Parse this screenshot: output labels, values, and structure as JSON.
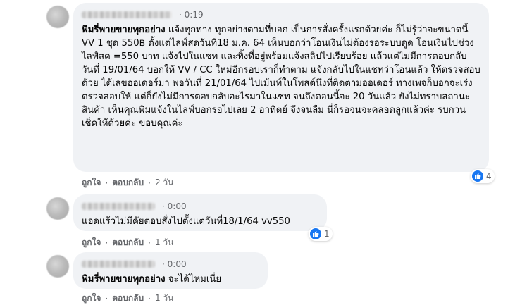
{
  "comments": [
    {
      "time": "0:19",
      "tagged_name": "พิมรี่พายขายทุกอย่าง",
      "text_after_tag": " แจ้งทุกทาง ทุกอย่างตามที่บอก เป็นการสั่งครั้งแรกด้วยค่ะ ก็ไม่รู้ว่าจะขนาดนี้",
      "body": "VV 1 ชุด 550฿ ตั้งแต่ไลฟ์สดวันที่18 ม.ค. 64 เห็นบอกว่าโอนเงินไม่ต้องรอระบบดูด โอนเงินไปช่วงไลฟ์สด =550 บาท แจ้งไปในแชท และทิ้งที่อยู่พร้อมแจ้งสลิปไปเรียบร้อย แล้วแต่ไม่มีการตอบกลับ วันที่ 19/01/64 บอกให้ VV / CC ใหม่อีกรอบเราก็ทำตาม แจ้งกลับไปในแชทว่าโอนแล้ว ให้ตรวจสอบด้วย ได้เลขออเดอร์มา พอวันที่ 21/01/64 ไปเม้นท์ในโพสต์นึงที่ติดตามออเดอร์ ทางเพจก็บอกจะเร่งตรวจสอบให้ แต่ก็ยังไม่มีการตอบกลับอะไรมาในแชท จนถึงตอนนี้จะ 20 วันแล้ว ยังไม่ทราบสถานะสินค้า เห็นคุณพิมแจ้งในไลฟ์บอกรอไปเลย 2 อาทิตย์ จึงจนลืม นี่ก็รอจนจะคลอดลูกแล้วค่ะ รบกวนเช็คให้ด้วยค่ะ ขอบคุณค่ะ",
      "like_label": "ถูกใจ",
      "reply_label": "ตอบกลับ",
      "age": "2 วัน",
      "reaction_count": "4"
    },
    {
      "time": "0:00",
      "text": "แอดแร้วไม่มีคัยตอบสั่งไปตั้งแต่วันที่18/1/64 vv550",
      "like_label": "ถูกใจ",
      "reply_label": "ตอบกลับ",
      "age": "1 วัน",
      "reaction_count": "1"
    },
    {
      "time": "0:00",
      "tagged_name": "พิมรี่พายขายทุกอย่าง",
      "text_after_tag": " จะได้ไหมเนี่ย",
      "like_label": "ถูกใจ",
      "reply_label": "ตอบกลับ",
      "age": "1 วัน"
    }
  ],
  "separator": "·",
  "colors": {
    "bubble": "#f0f2f5",
    "meta": "#65676b",
    "like_blue": "#1877f2"
  },
  "icons": {
    "reaction": "like-icon"
  }
}
